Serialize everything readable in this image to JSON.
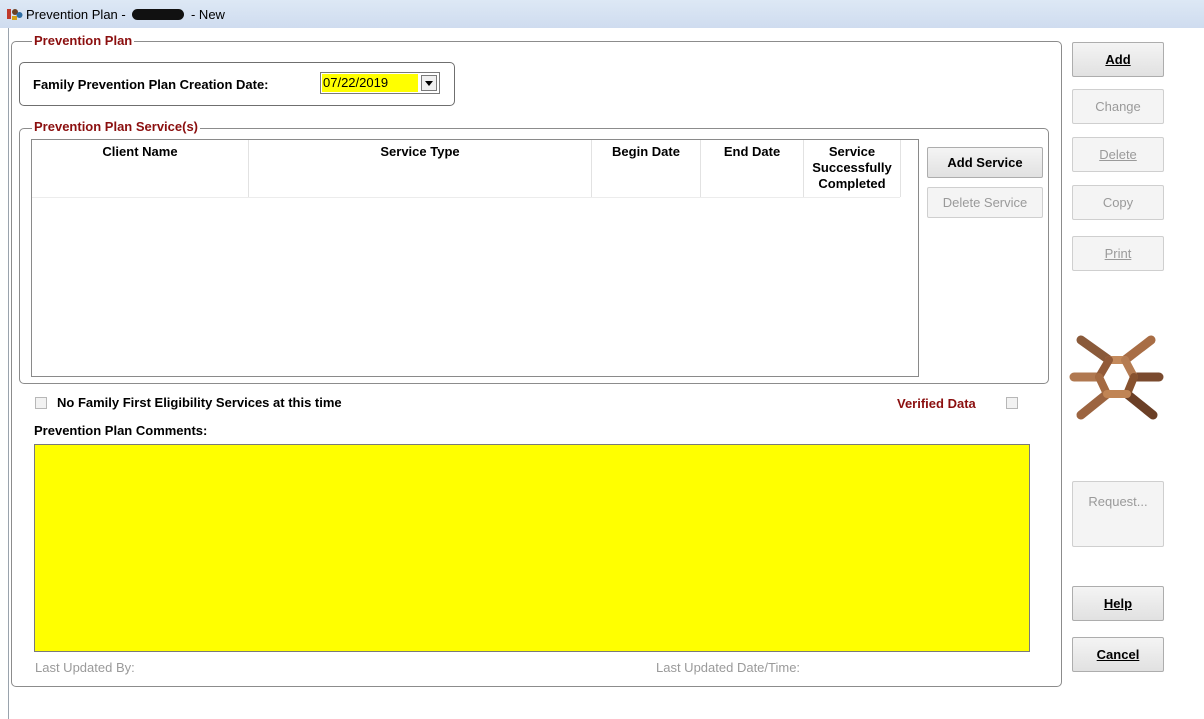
{
  "window": {
    "title_prefix": "Prevention Plan -",
    "title_suffix": "- New"
  },
  "plan_group": {
    "title": "Prevention Plan"
  },
  "creation_date": {
    "label": "Family Prevention Plan Creation Date:",
    "value": "07/22/2019"
  },
  "services_group": {
    "title": "Prevention Plan Service(s)",
    "columns": [
      "Client Name",
      "Service Type",
      "Begin Date",
      "End Date",
      "Service Successfully Completed"
    ],
    "rows": [],
    "add_service_label": "Add Service",
    "delete_service_label": "Delete Service"
  },
  "no_family_first": {
    "label": "No Family First Eligibility Services at this time",
    "checked": false
  },
  "verified_data": {
    "label": "Verified Data",
    "checked": false,
    "color": "#8b0f0f"
  },
  "comments": {
    "label": "Prevention Plan Comments:",
    "value": "",
    "background": "#ffff00"
  },
  "footer": {
    "last_updated_by_label": "Last Updated By:",
    "last_updated_datetime_label": "Last Updated Date/Time:"
  },
  "side_buttons": {
    "add": "Add",
    "change": "Change",
    "delete": "Delete",
    "copy": "Copy",
    "print": "Print",
    "request": "Request...",
    "help": "Help",
    "cancel": "Cancel"
  },
  "colors": {
    "group_title": "#8b0f0f",
    "highlight": "#ffff00"
  }
}
